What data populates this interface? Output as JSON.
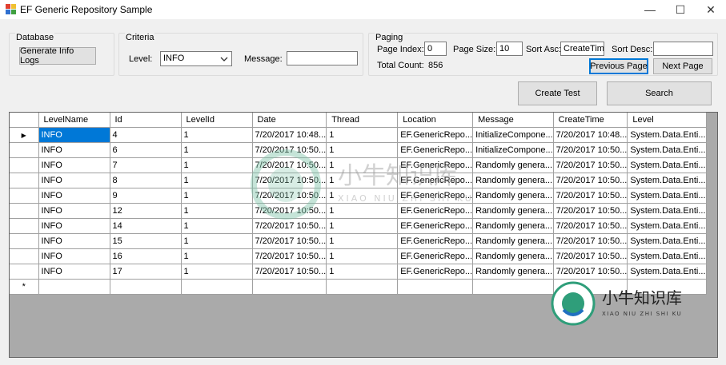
{
  "window": {
    "title": "EF Generic Repository Sample",
    "minimize": "—",
    "maximize": "☐",
    "close": "✕"
  },
  "database": {
    "legend": "Database",
    "generate_button": "Generate Info Logs"
  },
  "criteria": {
    "legend": "Criteria",
    "level_label": "Level:",
    "level_value": "INFO",
    "message_label": "Message:",
    "message_value": ""
  },
  "paging": {
    "legend": "Paging",
    "page_index_label": "Page Index:",
    "page_index_value": "0",
    "page_size_label": "Page Size:",
    "page_size_value": "10",
    "sort_asc_label": "Sort Asc:",
    "sort_asc_value": "CreateTime",
    "sort_desc_label": "Sort Desc:",
    "sort_desc_value": "",
    "total_count_label": "Total Count:",
    "total_count_value": "856",
    "previous_button": "Previous Page",
    "next_button": "Next Page"
  },
  "actions": {
    "create_test_button": "Create Test",
    "search_button": "Search"
  },
  "grid": {
    "columns": [
      "LevelName",
      "Id",
      "LevelId",
      "Date",
      "Thread",
      "Location",
      "Message",
      "CreateTime",
      "Level"
    ],
    "rows": [
      [
        "INFO",
        "4",
        "1",
        "7/20/2017 10:48...",
        "1",
        "EF.GenericRepo...",
        "InitializeCompone...",
        "7/20/2017 10:48...",
        "System.Data.Enti..."
      ],
      [
        "INFO",
        "6",
        "1",
        "7/20/2017 10:50...",
        "1",
        "EF.GenericRepo...",
        "InitializeCompone...",
        "7/20/2017 10:50...",
        "System.Data.Enti..."
      ],
      [
        "INFO",
        "7",
        "1",
        "7/20/2017 10:50...",
        "1",
        "EF.GenericRepo...",
        "Randomly genera...",
        "7/20/2017 10:50...",
        "System.Data.Enti..."
      ],
      [
        "INFO",
        "8",
        "1",
        "7/20/2017 10:50...",
        "1",
        "EF.GenericRepo...",
        "Randomly genera...",
        "7/20/2017 10:50...",
        "System.Data.Enti..."
      ],
      [
        "INFO",
        "9",
        "1",
        "7/20/2017 10:50...",
        "1",
        "EF.GenericRepo...",
        "Randomly genera...",
        "7/20/2017 10:50...",
        "System.Data.Enti..."
      ],
      [
        "INFO",
        "12",
        "1",
        "7/20/2017 10:50...",
        "1",
        "EF.GenericRepo...",
        "Randomly genera...",
        "7/20/2017 10:50...",
        "System.Data.Enti..."
      ],
      [
        "INFO",
        "14",
        "1",
        "7/20/2017 10:50...",
        "1",
        "EF.GenericRepo...",
        "Randomly genera...",
        "7/20/2017 10:50...",
        "System.Data.Enti..."
      ],
      [
        "INFO",
        "15",
        "1",
        "7/20/2017 10:50...",
        "1",
        "EF.GenericRepo...",
        "Randomly genera...",
        "7/20/2017 10:50...",
        "System.Data.Enti..."
      ],
      [
        "INFO",
        "16",
        "1",
        "7/20/2017 10:50...",
        "1",
        "EF.GenericRepo...",
        "Randomly genera...",
        "7/20/2017 10:50...",
        "System.Data.Enti..."
      ],
      [
        "INFO",
        "17",
        "1",
        "7/20/2017 10:50...",
        "1",
        "EF.GenericRepo...",
        "Randomly genera...",
        "7/20/2017 10:50...",
        "System.Data.Enti..."
      ]
    ],
    "current_row_glyph": "▶",
    "new_row_glyph": "*"
  },
  "watermark": {
    "brand_cn": "小牛知识库",
    "brand_en": "XIAO NIU ZHI SHI KU"
  },
  "colors": {
    "selection": "#0078d7",
    "grid_background": "#aaaaaa",
    "window_background": "#f0f0f0"
  },
  "icons": {
    "app": "app-icon",
    "dropdown": "chevron-down-icon"
  }
}
